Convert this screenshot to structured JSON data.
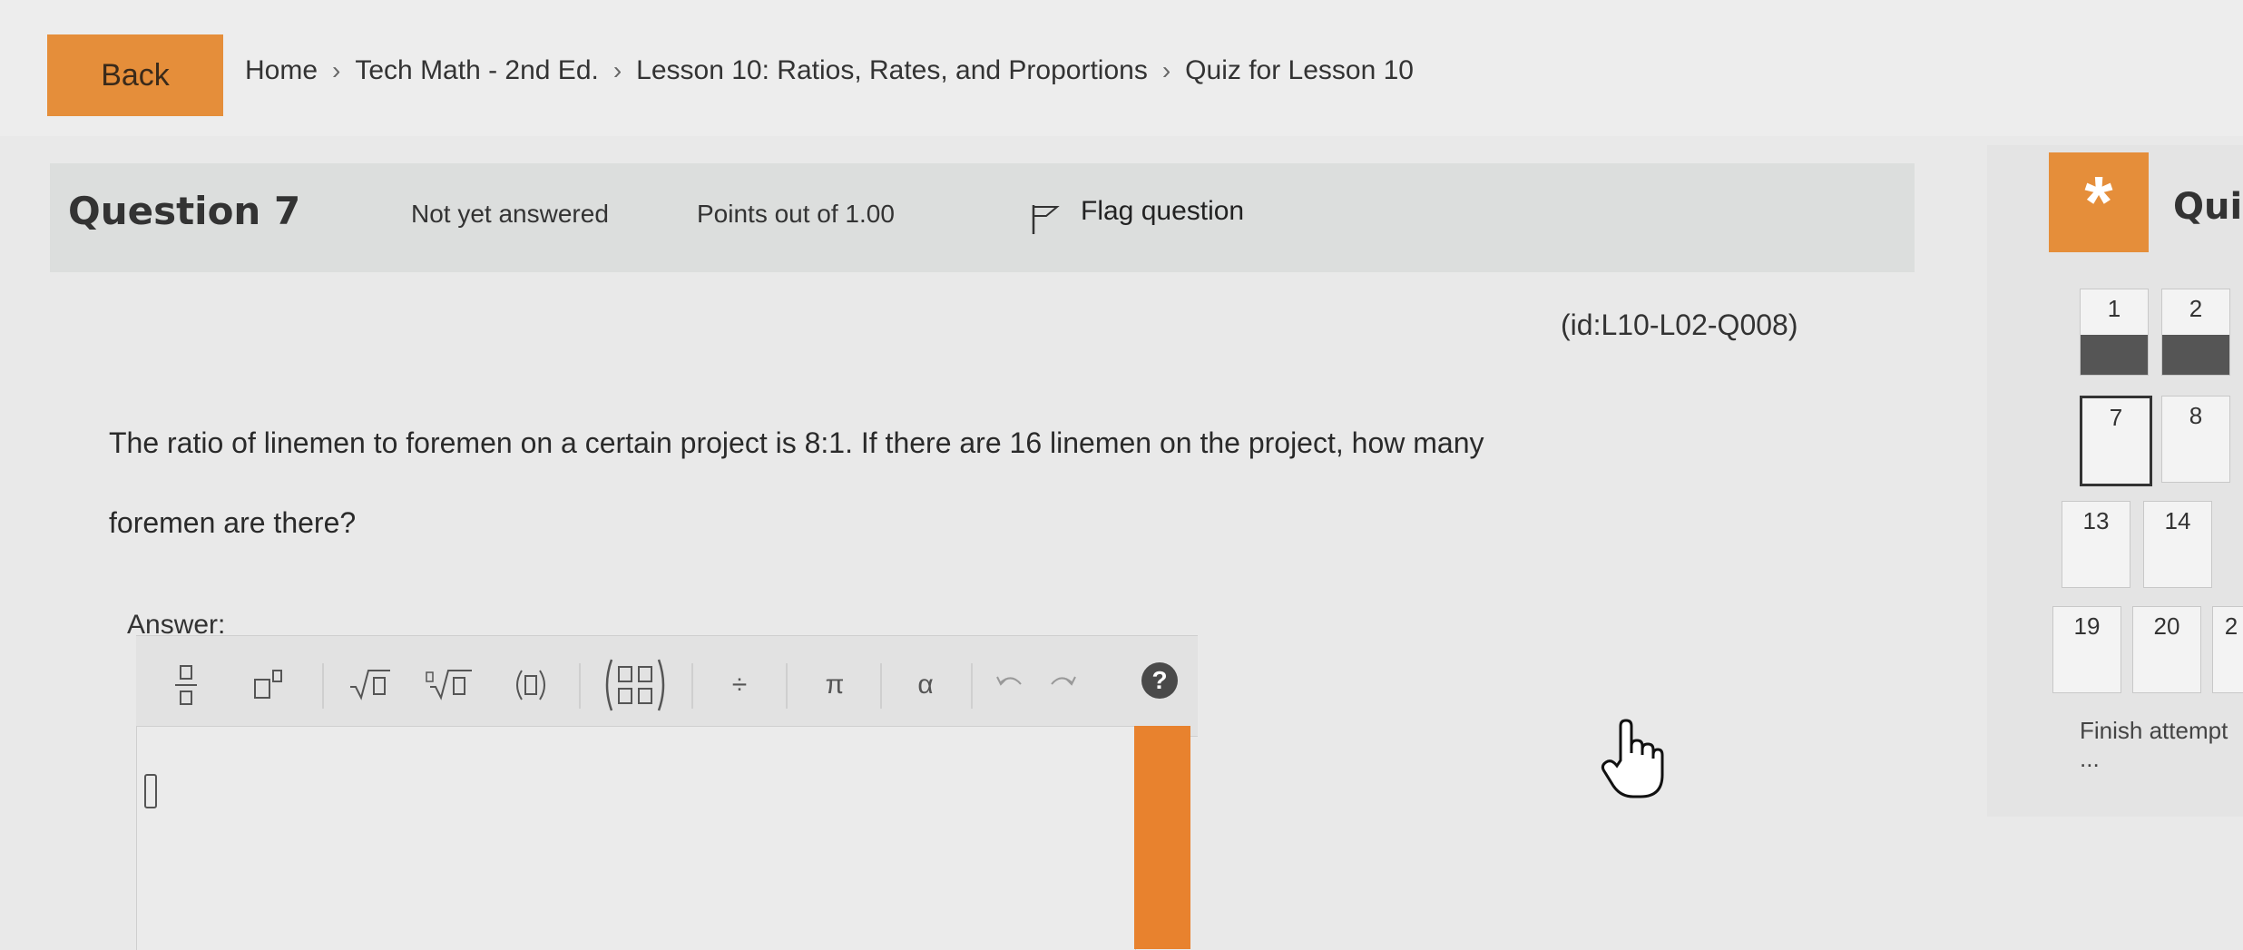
{
  "nav": {
    "back_label": "Back",
    "breadcrumb": [
      "Home",
      "Tech Math - 2nd Ed.",
      "Lesson 10: Ratios, Rates, and Proportions",
      "Quiz for Lesson 10"
    ],
    "separator": "›"
  },
  "question": {
    "title": "Question 7",
    "status": "Not yet answered",
    "points": "Points out of 1.00",
    "flag_label": "Flag question",
    "id_text": "(id:L10-L02-Q008)",
    "text_line1": "The ratio of linemen to foremen on a certain project is 8:1. If there are 16 linemen on the project, how many",
    "text_line2": "foremen are there?",
    "answer_label": "Answer:"
  },
  "toolbar": {
    "fraction": "▢⁄▢",
    "exponent": "▢▫",
    "sqrt": "√▢",
    "nthroot": "∛▢",
    "paren": "(▢)",
    "divide": "÷",
    "pi": "π",
    "alpha": "α",
    "help": "?"
  },
  "quiz_nav": {
    "icon": "*",
    "title": "Qui",
    "questions": [
      {
        "num": "1",
        "state": "answered"
      },
      {
        "num": "2",
        "state": "answered"
      },
      {
        "num": "7",
        "state": "current"
      },
      {
        "num": "8",
        "state": "empty"
      },
      {
        "num": "13",
        "state": "empty"
      },
      {
        "num": "14",
        "state": "empty"
      },
      {
        "num": "19",
        "state": "empty"
      },
      {
        "num": "20",
        "state": "empty"
      },
      {
        "num": "2",
        "state": "empty"
      }
    ],
    "finish_label": "Finish attempt ..."
  },
  "colors": {
    "accent": "#e58e3a",
    "orange_strip": "#e8822e",
    "answered": "#555555"
  }
}
